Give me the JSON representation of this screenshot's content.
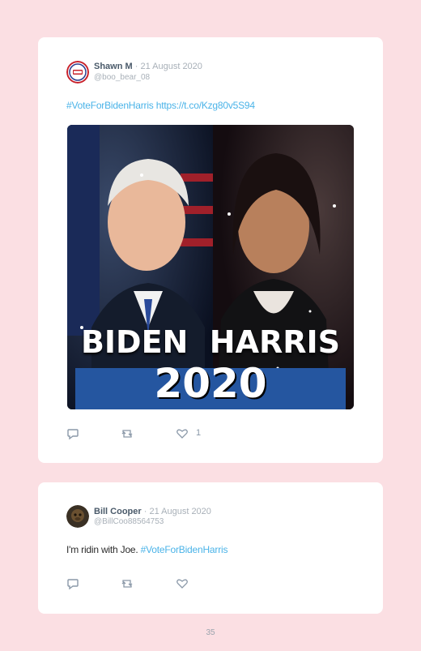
{
  "tweets": [
    {
      "author": "Shawn M",
      "date": "21 August 2020",
      "handle": "@boo_bear_08",
      "hashtag": "#VoteForBidenHarris",
      "link": "https://t.co/Kzg80v5S94",
      "image": {
        "headline": "BIDEN  HARRIS",
        "year": "2020"
      },
      "likes": "1",
      "icons": [
        "reply-icon",
        "retweet-icon",
        "heart-icon"
      ]
    },
    {
      "author": "Bill Cooper",
      "date": "21 August 2020",
      "handle": "@BillCoo88564753",
      "text": "I'm ridin with Joe.",
      "hashtag": "#VoteForBidenHarris",
      "icons": [
        "reply-icon",
        "retweet-icon",
        "heart-icon"
      ]
    }
  ],
  "page": {
    "number": "35",
    "date_separator": " · "
  },
  "colors": {
    "background": "#fbdfe3",
    "card": "#ffffff",
    "link": "#4ab3e8",
    "banner": "#2556a0"
  }
}
